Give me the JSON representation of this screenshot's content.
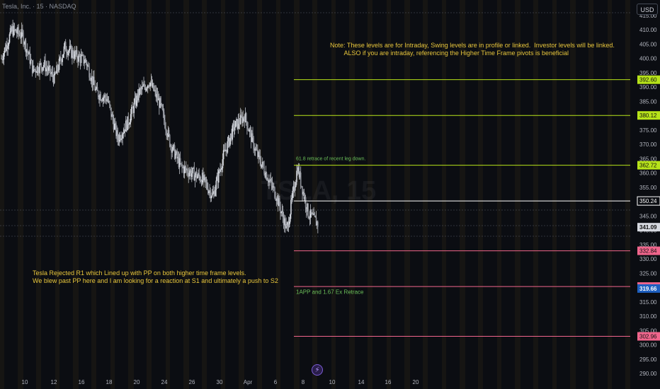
{
  "header": {
    "symbol": "Tesla, Inc. · 15 · NASDAQ",
    "currency_button": "USD"
  },
  "watermark": "TSLA, 15",
  "notes": {
    "top": "Note: These levels are for Intraday, Swing levels are in profile or linked.  Investor levels will be linked.\n        ALSO if you are intraday, referencing the Higher Time Frame pivots is beneficial",
    "bottom": "Tesla Rejected R1 which Lined up with PP on both higher time frame levels.\nWe blew past PP here and I am looking for a reaction at S1 and ultimately a push to S2"
  },
  "colors": {
    "background": "#0b0d12",
    "candle": "#d6d9e0",
    "green_level": "#b7e31a",
    "white_level": "#ffffff",
    "pink_level": "#f0658c",
    "blue_price": "#1e5fbf",
    "annotation_green": "#6bbf59",
    "annotation_gold": "#e8c63c"
  },
  "chart_data": {
    "type": "candlestick",
    "title": "",
    "x": [
      "10",
      "11",
      "12",
      "13",
      "14",
      "15",
      "16",
      "17",
      "18",
      "19",
      "20",
      "21",
      "22",
      "23",
      "24",
      "25",
      "26",
      "27",
      "28",
      "29",
      "30",
      "31",
      "Apr 1",
      "2",
      "3",
      "4",
      "5",
      "6",
      "7",
      "8",
      "9"
    ],
    "close": [
      400,
      410,
      408,
      396,
      398,
      393,
      404,
      401,
      399,
      388,
      386,
      372,
      378,
      388,
      392,
      384,
      370,
      362,
      360,
      358,
      352,
      366,
      376,
      380,
      368,
      360,
      352,
      340,
      362,
      346,
      342
    ],
    "x_tick_labels": [
      "10",
      "12",
      "16",
      "18",
      "20",
      "24",
      "26",
      "30",
      "Apr",
      "6",
      "8",
      "10",
      "14",
      "16",
      "20"
    ],
    "y_tick_labels": [
      "290.00",
      "295.00",
      "300.00",
      "305.00",
      "310.00",
      "315.00",
      "320.00",
      "325.00",
      "330.00",
      "335.00",
      "340.00",
      "345.00",
      "350.00",
      "355.00",
      "360.00",
      "365.00",
      "370.00",
      "375.00",
      "380.00",
      "385.00",
      "390.00",
      "395.00",
      "400.00",
      "405.00",
      "410.00",
      "415.00"
    ],
    "ylim": [
      288,
      418
    ],
    "levels": [
      {
        "value": 392.6,
        "label": "392.60",
        "color": "#b7e31a"
      },
      {
        "value": 380.12,
        "label": "380.12",
        "color": "#b7e31a"
      },
      {
        "value": 362.72,
        "label": "362.72",
        "color": "#b7e31a"
      },
      {
        "value": 350.24,
        "label": "350.24",
        "color": "#ffffff"
      },
      {
        "value": 332.84,
        "label": "332.84",
        "color": "#f0658c"
      },
      {
        "value": 320.36,
        "label": "320.36",
        "color": "#f0658c"
      },
      {
        "value": 302.96,
        "label": "302.96",
        "color": "#f0658c"
      }
    ],
    "price_tags": [
      {
        "value": 341.09,
        "label": "341.09",
        "kind": "last"
      },
      {
        "value": 319.66,
        "label": "319.66",
        "kind": "blue"
      }
    ],
    "annotations": [
      {
        "text": "61.8 retrace of recent leg down.",
        "value": 364.5,
        "color": "#6bbf59"
      },
      {
        "text": "1APP and 1.67 Ex Retrace",
        "value": 317.8,
        "color": "#6bbf59"
      }
    ],
    "grid": false,
    "legend": "none"
  }
}
